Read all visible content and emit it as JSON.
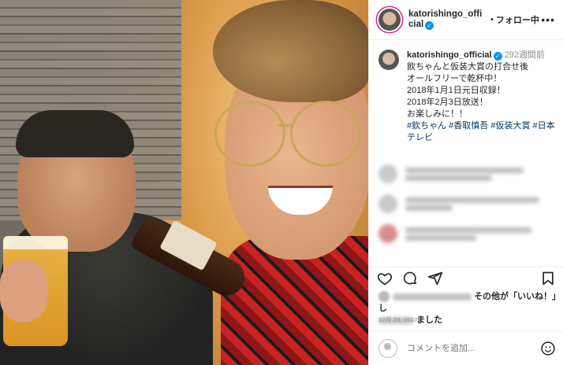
{
  "post": {
    "username": "katorishingo_official",
    "follow_separator": "•",
    "follow_label": "フォロー中",
    "more_label": "•••",
    "caption": {
      "age": "292週間前",
      "lines": [
        "飲ちゃんと仮装大賞の打合せ後",
        "オールフリーで乾杯中！",
        "2018年1月1日元日収録！",
        "2018年2月3日放送！",
        "お楽しみに！！"
      ],
      "hashtags_line1": "#欽ちゃん #香取慎吾 #仮装大賞 #日本",
      "hashtags_line2": "テレビ"
    },
    "likes": {
      "text": "その他が「いいね！」し",
      "text2": "ました"
    },
    "date": "12月 28, 2017",
    "comment_placeholder": "コメントを追加...",
    "icons": {
      "like": "heart-icon",
      "comment": "comment-icon",
      "share": "share-icon",
      "save": "bookmark-icon",
      "emoji": "emoji-icon"
    },
    "colors": {
      "verified": "#0095f6",
      "link": "#00376b",
      "muted": "#8e8e8e",
      "text": "#262626"
    }
  }
}
